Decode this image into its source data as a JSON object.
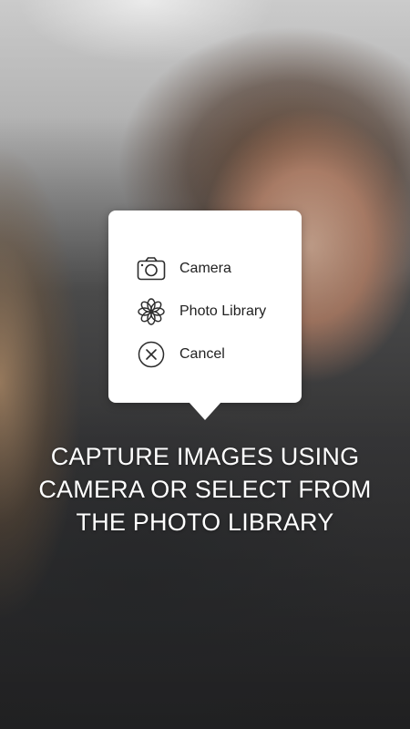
{
  "popover": {
    "items": [
      {
        "label": "Camera",
        "icon": "camera-icon"
      },
      {
        "label": "Photo Library",
        "icon": "flower-icon"
      },
      {
        "label": "Cancel",
        "icon": "close-circle-icon"
      }
    ]
  },
  "caption": {
    "text": "CAPTURE IMAGES USING CAMERA OR SELECT FROM THE PHOTO LIBRARY"
  },
  "colors": {
    "popover_bg": "#ffffff",
    "caption_text": "#ffffff",
    "item_text": "#222222",
    "icon_stroke": "#2b2b2b"
  }
}
